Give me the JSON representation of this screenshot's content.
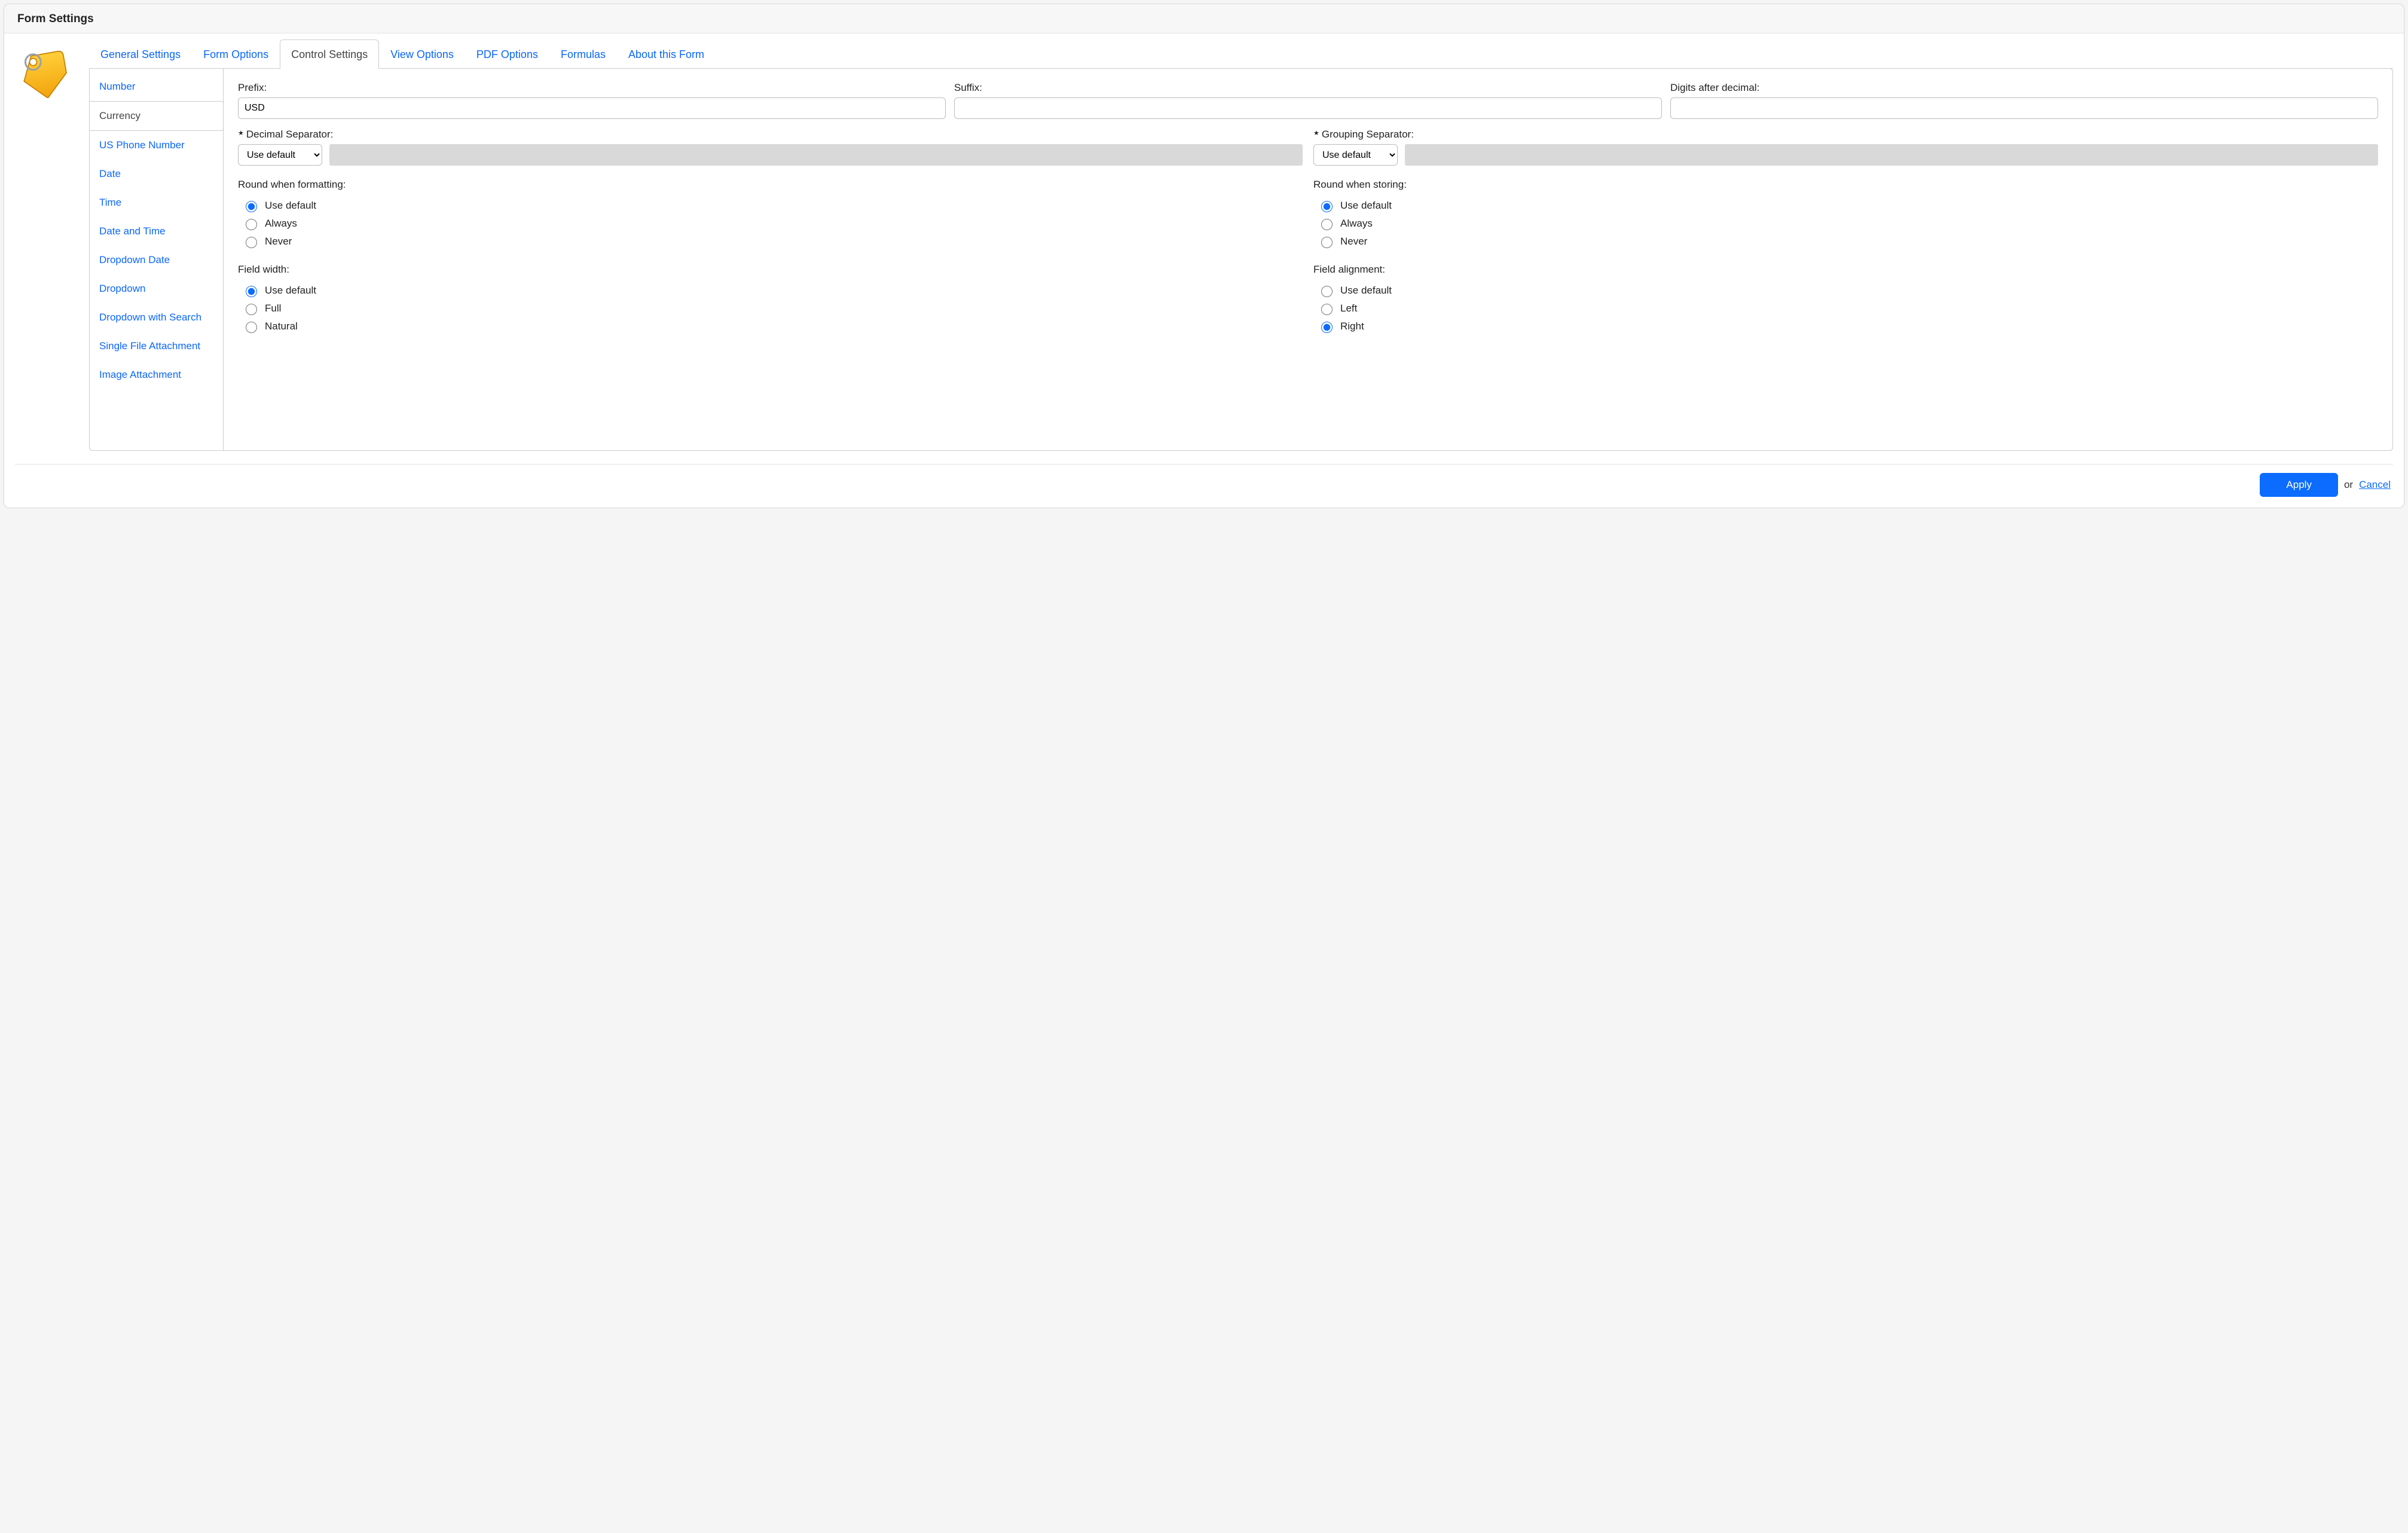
{
  "title": "Form Settings",
  "tabs": [
    "General Settings",
    "Form Options",
    "Control Settings",
    "View Options",
    "PDF Options",
    "Formulas",
    "About this Form"
  ],
  "active_tab": "Control Settings",
  "sidebar": {
    "items": [
      "Number",
      "Currency",
      "US Phone Number",
      "Date",
      "Time",
      "Date and Time",
      "Dropdown Date",
      "Dropdown",
      "Dropdown with Search",
      "Single File Attachment",
      "Image Attachment"
    ],
    "selected": "Currency"
  },
  "fields": {
    "prefix": {
      "label": "Prefix:",
      "value": "USD"
    },
    "suffix": {
      "label": "Suffix:",
      "value": ""
    },
    "digits_after_decimal": {
      "label": "Digits after decimal:",
      "value": ""
    },
    "decimal_separator": {
      "label": "Decimal Separator:",
      "value": "Use default"
    },
    "grouping_separator": {
      "label": "Grouping Separator:",
      "value": "Use default"
    }
  },
  "radio_groups": {
    "round_formatting": {
      "label": "Round when formatting:",
      "options": [
        "Use default",
        "Always",
        "Never"
      ],
      "selected": "Use default"
    },
    "round_storing": {
      "label": "Round when storing:",
      "options": [
        "Use default",
        "Always",
        "Never"
      ],
      "selected": "Use default"
    },
    "field_width": {
      "label": "Field width:",
      "options": [
        "Use default",
        "Full",
        "Natural"
      ],
      "selected": "Use default"
    },
    "field_alignment": {
      "label": "Field alignment:",
      "options": [
        "Use default",
        "Left",
        "Right"
      ],
      "selected": "Right"
    }
  },
  "footer": {
    "apply": "Apply",
    "or": "or",
    "cancel": "Cancel"
  }
}
